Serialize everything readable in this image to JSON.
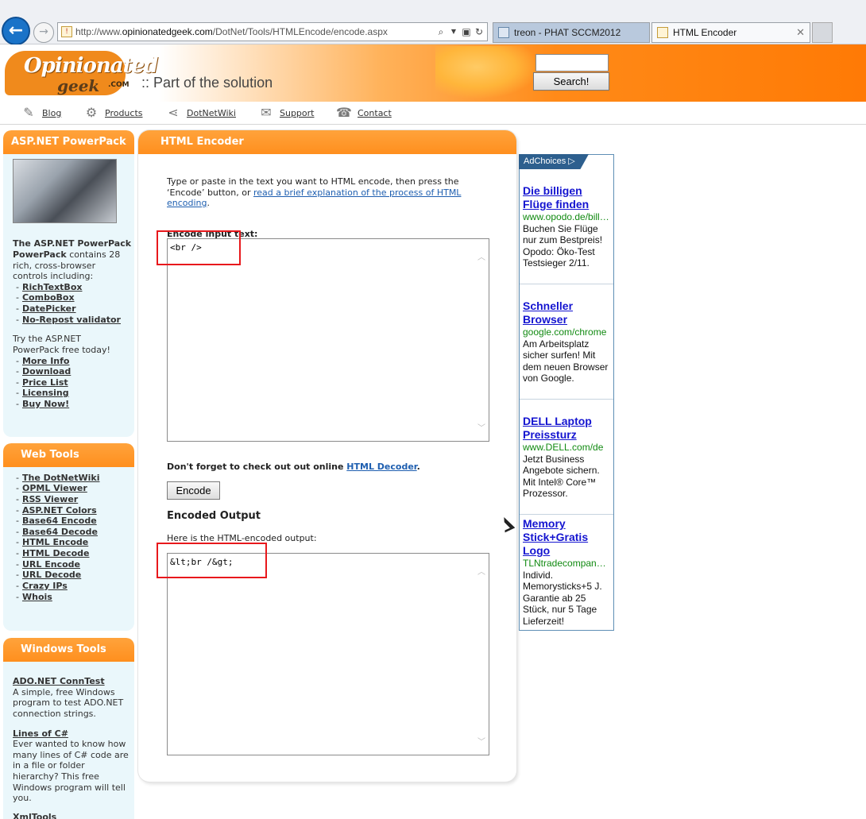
{
  "browser": {
    "url_prefix": "http://www.",
    "url_domain": "opinionatedgeek.com",
    "url_path": "/DotNet/Tools/HTMLEncode/encode.aspx",
    "tabs": [
      {
        "label": "treon - PHAT SCCM2012"
      },
      {
        "label": "HTML Encoder"
      }
    ]
  },
  "header": {
    "logo_top": "Opinionated",
    "logo_bottom": "geek",
    "logo_com": ".COM",
    "tagline": ":: Part of the solution",
    "search_button": "Search!"
  },
  "nav": {
    "items": [
      {
        "label": "Blog",
        "icon": "blog-icon"
      },
      {
        "label": "Products",
        "icon": "gear-icon"
      },
      {
        "label": "DotNetWiki",
        "icon": "share-icon"
      },
      {
        "label": "Support",
        "icon": "mail-icon"
      },
      {
        "label": "Contact",
        "icon": "phone-icon"
      }
    ]
  },
  "sidebar": {
    "powerpack": {
      "title": "ASP.NET PowerPack",
      "intro_bold": "The ASP.NET PowerPack",
      "intro_rest_1": " contains 28",
      "intro_line2": "rich, cross-browser",
      "intro_line3": "controls including:",
      "controls": [
        "RichTextBox",
        "ComboBox",
        "DatePicker",
        "No-Repost validator"
      ],
      "try_line1": "Try the ASP.NET",
      "try_line2": "PowerPack free today!",
      "links": [
        "More Info",
        "Download",
        "Price List",
        "Licensing",
        "Buy Now!"
      ]
    },
    "web_tools": {
      "title": "Web Tools",
      "links": [
        "The DotNetWiki",
        "OPML Viewer",
        "RSS Viewer",
        "ASP.NET Colors",
        "Base64 Encode",
        "Base64 Decode",
        "HTML Encode",
        "HTML Decode",
        "URL Encode",
        "URL Decode",
        "Crazy IPs",
        "Whois"
      ]
    },
    "windows_tools": {
      "title": "Windows Tools",
      "item1_title": "ADO.NET ConnTest",
      "item1_lines": [
        "A simple, free Windows",
        "program to test ADO.NET",
        "connection strings."
      ],
      "item2_title": "Lines of C#",
      "item2_lines": [
        "Ever wanted to know how",
        "many lines of C# code are",
        "in a file or folder",
        "hierarchy?  This free",
        "Windows program will tell",
        "you."
      ],
      "item3_title": "XmlTools"
    }
  },
  "main": {
    "title": "HTML Encoder",
    "intro_text_1": "Type or paste in the text you want to HTML encode, then press the ‘Encode’ button, or ",
    "intro_link": "read a brief explanation of the process of HTML encoding",
    "intro_text_2": ".",
    "input_label": "Encode input text:",
    "input_value": "<br />",
    "decoder_text": "Don't forget to check out out online ",
    "decoder_link": "HTML Decoder",
    "decoder_end": ".",
    "encode_button": "Encode",
    "output_title": "Encoded Output",
    "output_label": "Here is the HTML-encoded output:",
    "output_value": "&lt;br /&gt;"
  },
  "ads": {
    "adchoices": "AdChoices",
    "items": [
      {
        "title": "Die billigen Flüge finden",
        "url": "www.opodo.de/bill…",
        "text": "Buchen Sie Flüge nur zum Bestpreis! Opodo: Öko-Test Testsieger 2/11."
      },
      {
        "title": "Schneller Browser",
        "url": "google.com/chrome",
        "text": "Am Arbeitsplatz sicher surfen! Mit dem neuen Browser von Google."
      },
      {
        "title": "DELL Laptop Preissturz",
        "url": "www.DELL.com/de",
        "text": "Jetzt Business Angebote sichern. Mit Intel® Core™ Prozessor."
      },
      {
        "title": "Memory Stick+Gratis Logo",
        "url": "TLNtradecompan…",
        "text": "Individ. Memorysticks+5 J. Garantie ab 25 Stück, nur 5 Tage Lieferzeit!"
      }
    ]
  }
}
